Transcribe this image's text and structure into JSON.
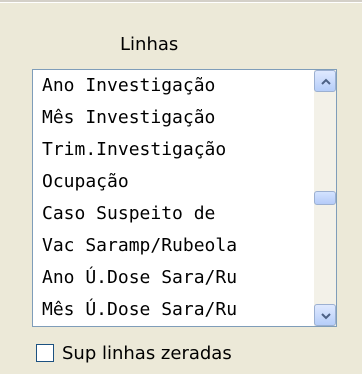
{
  "group": {
    "label": "Linhas"
  },
  "list": {
    "items": [
      "Ano Investigação",
      "Mês Investigação",
      "Trim.Investigação",
      "Ocupação",
      "Caso Suspeito de",
      "Vac Saramp/Rubeola",
      "Ano Ú.Dose Sara/Ru",
      "Mês Ú.Dose Sara/Ru"
    ]
  },
  "checkbox": {
    "label": "Sup linhas zeradas",
    "checked": false
  },
  "icons": {
    "scroll_up": "chevron-up-icon",
    "scroll_down": "chevron-down-icon"
  }
}
